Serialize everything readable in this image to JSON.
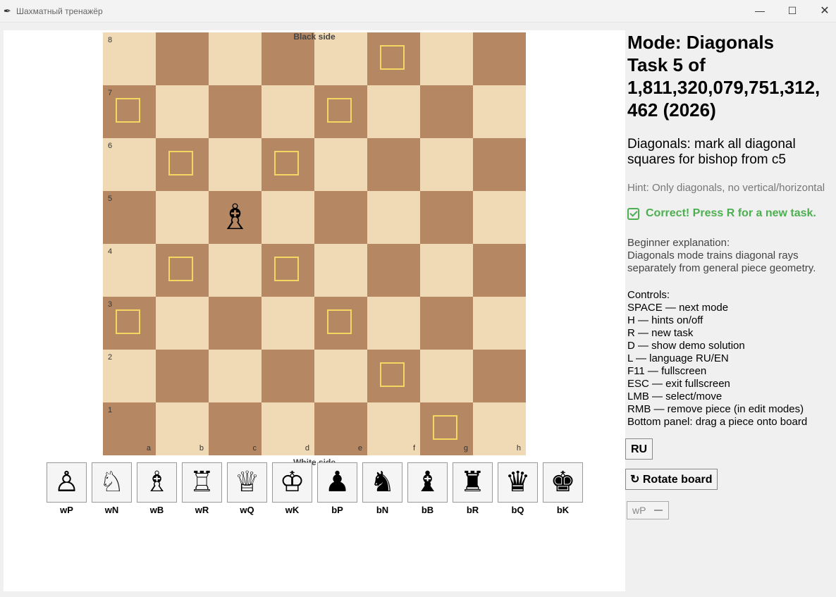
{
  "window": {
    "title": "Шахматный тренажёр",
    "app_icon": "feather-icon",
    "minimize_glyph": "—",
    "maximize_glyph": "☐",
    "close_glyph": "✕"
  },
  "board": {
    "top_label": "Black side",
    "bottom_label": "White side",
    "files": [
      "a",
      "b",
      "c",
      "d",
      "e",
      "f",
      "g",
      "h"
    ],
    "ranks": [
      "8",
      "7",
      "6",
      "5",
      "4",
      "3",
      "2",
      "1"
    ],
    "pieces": [
      {
        "square": "c5",
        "code": "wB",
        "glyph": "♗"
      }
    ],
    "marked_squares": [
      "f8",
      "a7",
      "e7",
      "b6",
      "d6",
      "b4",
      "d4",
      "a3",
      "e3",
      "f2",
      "g1"
    ],
    "light_color": "#f0d9b5",
    "dark_color": "#b58863",
    "mark_color": "#f4d663"
  },
  "palette": [
    {
      "code": "wP",
      "glyph": "♙"
    },
    {
      "code": "wN",
      "glyph": "♘"
    },
    {
      "code": "wB",
      "glyph": "♗"
    },
    {
      "code": "wR",
      "glyph": "♖"
    },
    {
      "code": "wQ",
      "glyph": "♕"
    },
    {
      "code": "wK",
      "glyph": "♔"
    },
    {
      "code": "bP",
      "glyph": "♟"
    },
    {
      "code": "bN",
      "glyph": "♞"
    },
    {
      "code": "bB",
      "glyph": "♝"
    },
    {
      "code": "bR",
      "glyph": "♜"
    },
    {
      "code": "bQ",
      "glyph": "♛"
    },
    {
      "code": "bK",
      "glyph": "♚"
    }
  ],
  "panel": {
    "mode_line": "Mode: Diagonals",
    "task_line1": "Task 5 of",
    "task_line2": "1,811,320,079,751,312,",
    "task_line3": "462 (2026)",
    "task_desc_line1": "Diagonals: mark all diagonal",
    "task_desc_line2": "squares for bishop from c5",
    "hint": "Hint: Only diagonals, no vertical/horizontal",
    "status": "Correct! Press R for a new task.",
    "status_color": "#4caf50",
    "explanation": [
      "Beginner explanation:",
      "Diagonals mode trains diagonal rays",
      "separately from general piece geometry."
    ],
    "controls": [
      "Controls:",
      "SPACE — next mode",
      "H — hints on/off",
      "R — new task",
      "D — show demo solution",
      "L — language RU/EN",
      "F11 — fullscreen",
      "ESC — exit fullscreen",
      "LMB — select/move",
      "RMB — remove piece (in edit modes)",
      "Bottom panel: drag a piece onto board"
    ],
    "lang_button": "RU",
    "rotate_button": "Rotate board",
    "rotate_icon": "↻",
    "piece_select_value": "wP"
  }
}
